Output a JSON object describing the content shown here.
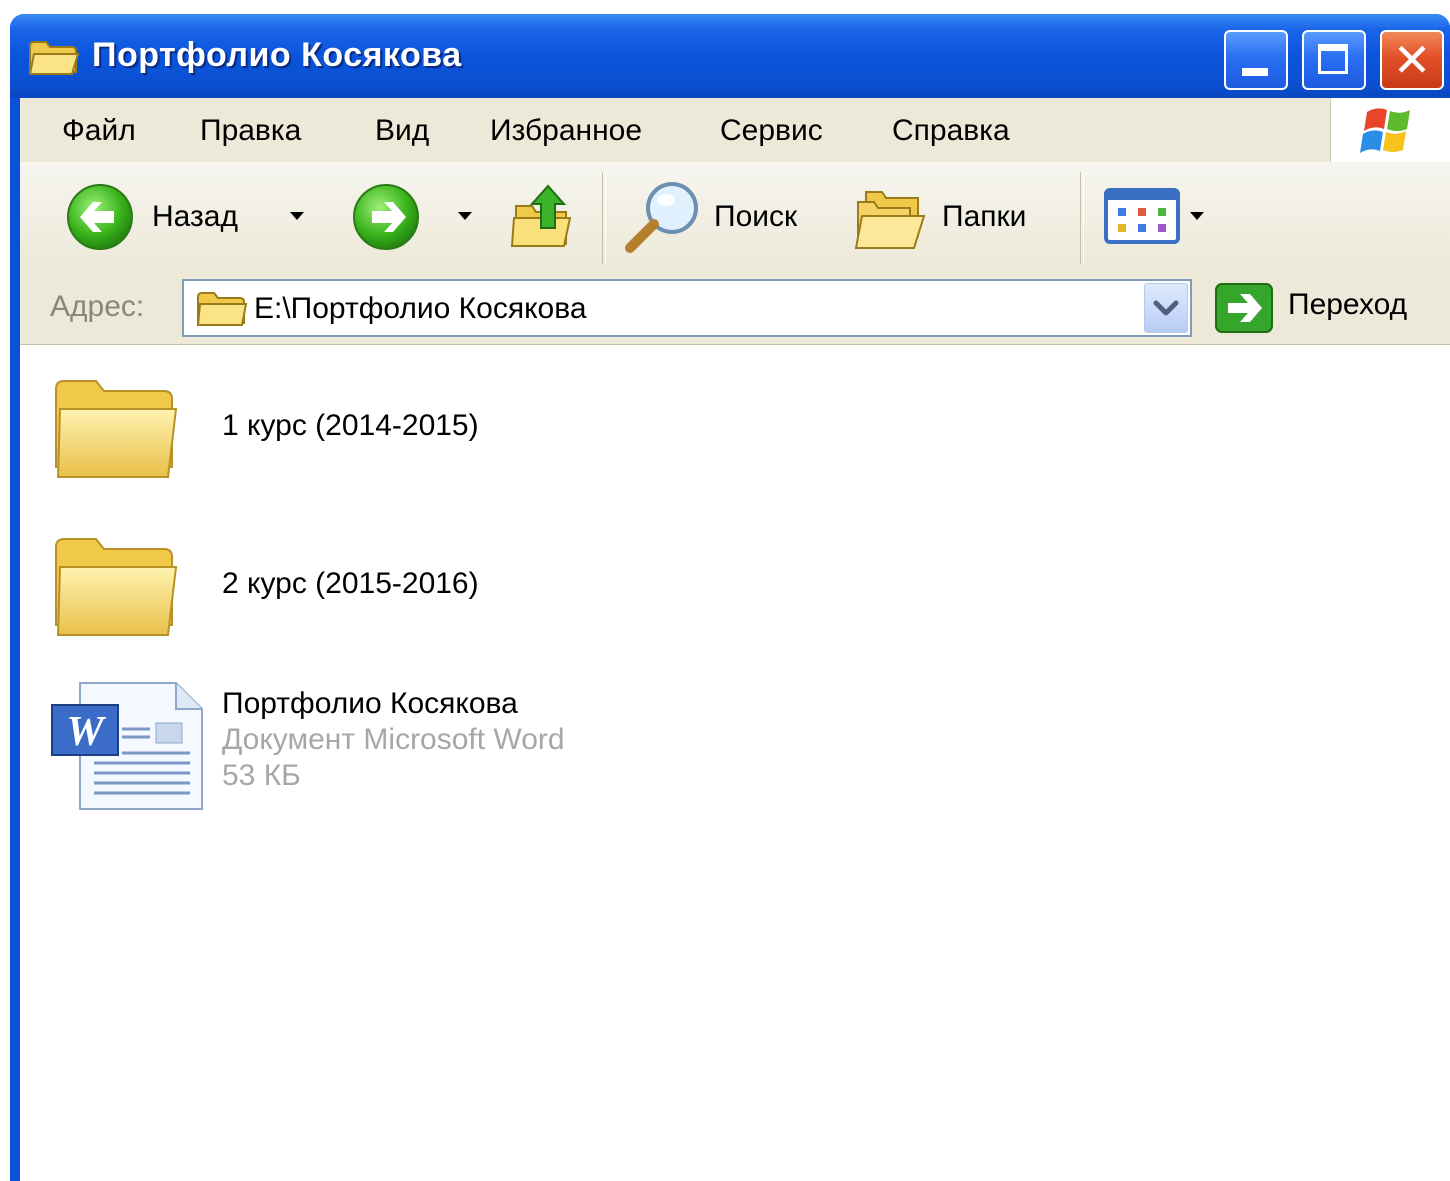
{
  "window": {
    "title": "Портфолио Косякова"
  },
  "menu": {
    "items": [
      "Файл",
      "Правка",
      "Вид",
      "Избранное",
      "Сервис",
      "Справка"
    ]
  },
  "toolbar": {
    "back_label": "Назад",
    "search_label": "Поиск",
    "folders_label": "Папки"
  },
  "address": {
    "label": "Адрес:",
    "value": "E:\\Портфолио Косякова",
    "go_label": "Переход"
  },
  "items": [
    {
      "type": "folder",
      "name": "1 курс (2014-2015)"
    },
    {
      "type": "folder",
      "name": "2 курс (2015-2016)"
    },
    {
      "type": "word-document",
      "name": "Портфолио Косякова",
      "kind": "Документ Microsoft Word",
      "size": "53 КБ"
    }
  ],
  "colors": {
    "titlebar": "#0a55dc",
    "chrome": "#ece9d8",
    "close_button": "#e2502a",
    "folder": "#f3d56a"
  }
}
